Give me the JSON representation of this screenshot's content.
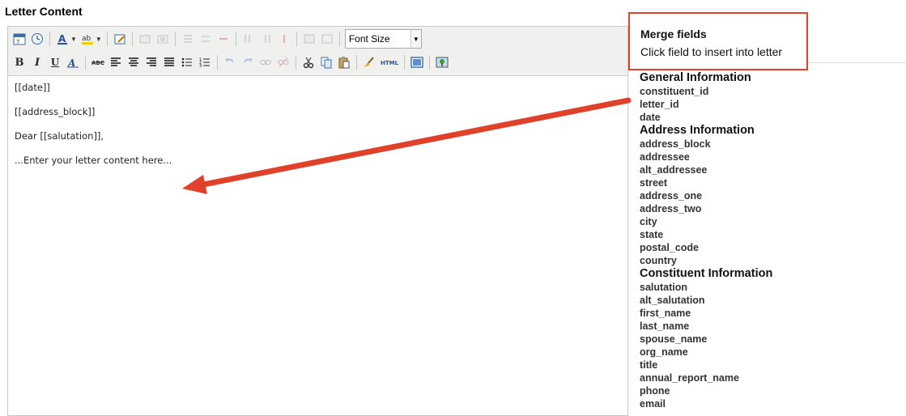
{
  "section_title": "Letter Content",
  "toolbar": {
    "font_size_label": "Font Size"
  },
  "editor": {
    "lines": [
      "[[date]]",
      "[[address_block]]",
      "Dear [[salutation]],",
      "...Enter your letter content here..."
    ]
  },
  "merge": {
    "title": "Merge fields",
    "subtitle": "Click field to insert into letter"
  },
  "groups": [
    {
      "title": "General Information",
      "fields": [
        "constituent_id",
        "letter_id",
        "date"
      ]
    },
    {
      "title": "Address Information",
      "fields": [
        "address_block",
        "addressee",
        "alt_addressee",
        "street",
        "address_one",
        "address_two",
        "city",
        "state",
        "postal_code",
        "country"
      ]
    },
    {
      "title": "Constituent Information",
      "fields": [
        "salutation",
        "alt_salutation",
        "first_name",
        "last_name",
        "spouse_name",
        "org_name",
        "title",
        "annual_report_name",
        "phone",
        "email"
      ]
    }
  ],
  "colors": {
    "highlight": "#e0412b"
  }
}
